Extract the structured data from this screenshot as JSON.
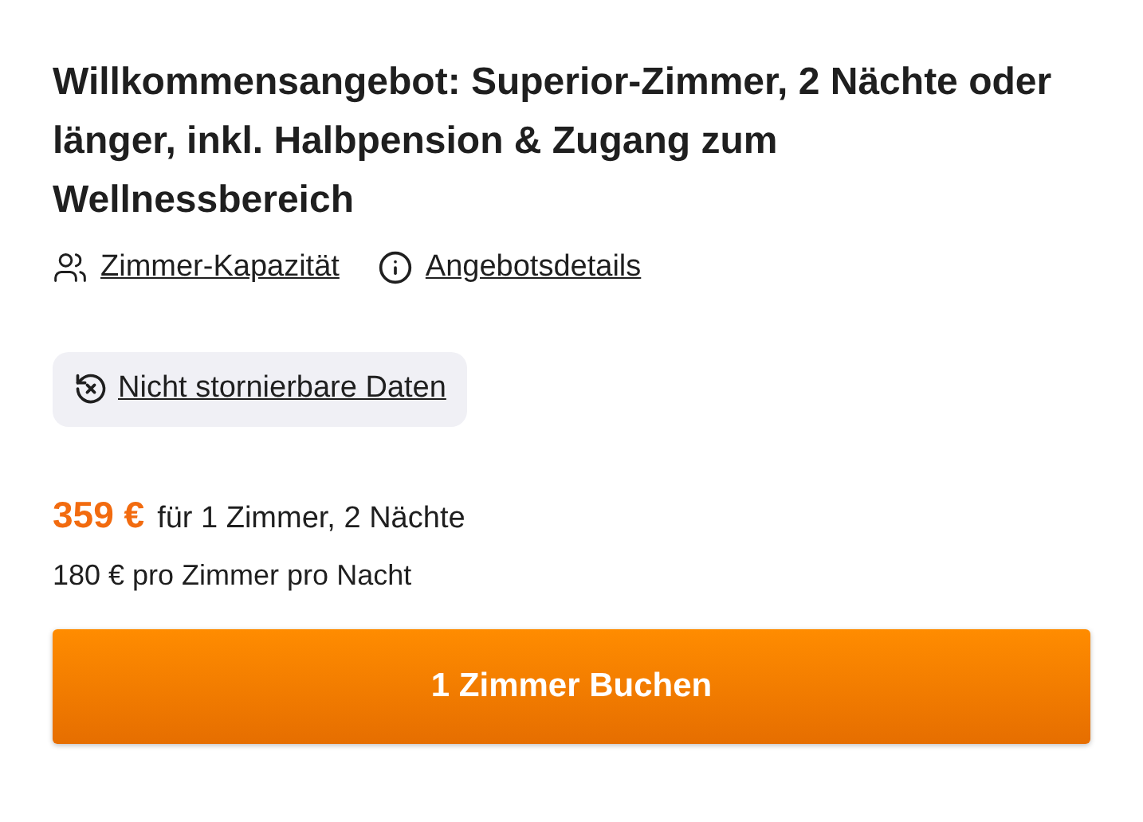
{
  "title": "Willkommensangebot: Superior-Zimmer, 2 Nächte oder länger, inkl. Halbpension & Zugang zum Wellnessbereich",
  "links": [
    {
      "kind": "capacity",
      "label": "Zimmer-Kapazität"
    },
    {
      "kind": "info",
      "label": "Angebotsdetails"
    }
  ],
  "cancellation_badge": {
    "label": "Nicht stornierbare Daten"
  },
  "price": {
    "total": "359 €",
    "total_note": "für 1 Zimmer, 2 Nächte",
    "per_night": "180 € pro Zimmer pro Nacht"
  },
  "book_button": {
    "label": "1 Zimmer Buchen"
  }
}
